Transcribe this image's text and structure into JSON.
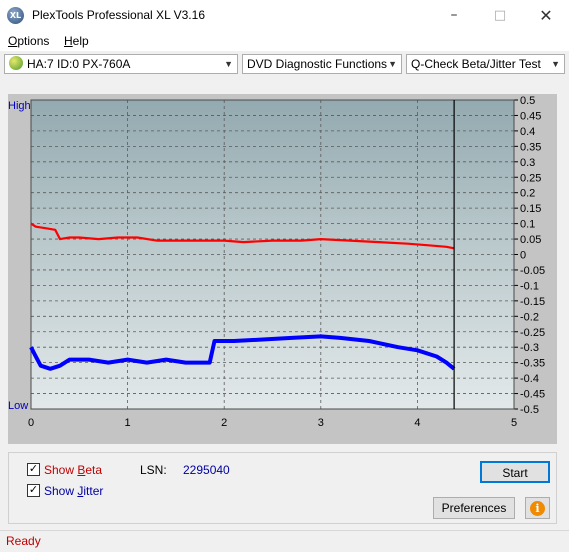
{
  "window": {
    "title": "PlexTools Professional XL V3.16",
    "app_icon_text": "XL"
  },
  "menu": {
    "items": [
      {
        "label": "Options",
        "key": "O"
      },
      {
        "label": "Help",
        "key": "H"
      }
    ]
  },
  "toolbar": {
    "drive": "HA:7 ID:0  PX-760A",
    "function": "DVD Diagnostic Functions",
    "test": "Q-Check Beta/Jitter Test"
  },
  "chart_data": {
    "type": "line",
    "x_ticks": [
      "0",
      "1",
      "2",
      "3",
      "4",
      "5"
    ],
    "xlim": [
      0,
      5
    ],
    "ylim": [
      -0.5,
      0.5
    ],
    "y_left_labels": {
      "top": "High",
      "bottom": "Low"
    },
    "y_right_ticks": [
      "0.5",
      "0.45",
      "0.4",
      "0.35",
      "0.3",
      "0.25",
      "0.2",
      "0.15",
      "0.1",
      "0.05",
      "0",
      "-0.05",
      "-0.1",
      "-0.15",
      "-0.2",
      "-0.25",
      "-0.3",
      "-0.35",
      "-0.4",
      "-0.45",
      "-0.5"
    ],
    "end_marker_x": 4.38,
    "grid": true,
    "series": [
      {
        "name": "Beta",
        "color": "#ff0000",
        "x": [
          0,
          0.05,
          0.15,
          0.25,
          0.3,
          0.4,
          0.5,
          0.7,
          0.9,
          1.1,
          1.3,
          1.5,
          1.8,
          2.0,
          2.2,
          2.5,
          2.8,
          3.0,
          3.3,
          3.6,
          3.9,
          4.1,
          4.3,
          4.38
        ],
        "y": [
          0.1,
          0.09,
          0.085,
          0.08,
          0.05,
          0.055,
          0.055,
          0.05,
          0.055,
          0.055,
          0.045,
          0.045,
          0.045,
          0.045,
          0.04,
          0.045,
          0.045,
          0.05,
          0.045,
          0.04,
          0.035,
          0.03,
          0.025,
          0.02
        ]
      },
      {
        "name": "Jitter",
        "color": "#0000ff",
        "x": [
          0,
          0.05,
          0.1,
          0.2,
          0.3,
          0.4,
          0.6,
          0.8,
          1.0,
          1.2,
          1.4,
          1.6,
          1.85,
          1.9,
          2.1,
          2.4,
          2.7,
          3.0,
          3.2,
          3.5,
          3.8,
          4.0,
          4.2,
          4.3,
          4.38
        ],
        "y": [
          -0.3,
          -0.33,
          -0.36,
          -0.37,
          -0.36,
          -0.34,
          -0.34,
          -0.35,
          -0.34,
          -0.35,
          -0.34,
          -0.35,
          -0.35,
          -0.28,
          -0.28,
          -0.275,
          -0.27,
          -0.265,
          -0.27,
          -0.28,
          -0.3,
          -0.31,
          -0.33,
          -0.35,
          -0.37
        ]
      }
    ]
  },
  "controls": {
    "show_beta": {
      "prefix": "Show ",
      "key": "B",
      "rest": "eta",
      "color": "#c00000",
      "checked": true
    },
    "show_jitter": {
      "prefix": "Show ",
      "key": "J",
      "rest": "itter",
      "color": "#0000a0",
      "checked": true
    },
    "lsn_label": "LSN:",
    "lsn_value": "2295040",
    "start_button": "Start",
    "preferences_button": "Preferences",
    "info_icon": "info-icon"
  },
  "status": {
    "text": "Ready",
    "color": "#c00000"
  }
}
